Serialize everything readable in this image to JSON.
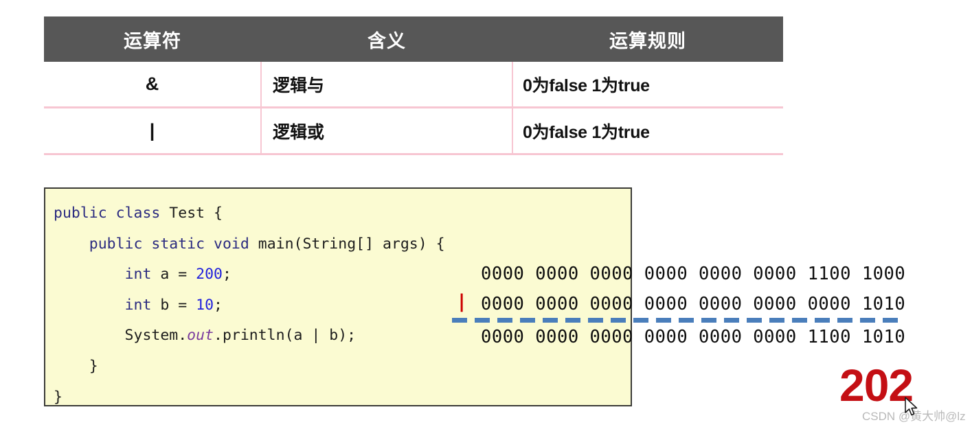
{
  "table": {
    "headers": [
      "运算符",
      "含义",
      "运算规则"
    ],
    "rows": [
      {
        "operator": "&",
        "meaning": "逻辑与",
        "rule": "0为false 1为true"
      },
      {
        "operator": "|",
        "meaning": "逻辑或",
        "rule": "0为false 1为true"
      }
    ],
    "colors": {
      "header_bg": "#575757",
      "header_text": "#ffffff",
      "divider": "#f7c6d2"
    }
  },
  "code": {
    "language": "java",
    "background": "#fbfbd2",
    "border": "#3a3a36",
    "lines": [
      {
        "tokens": [
          {
            "t": "public",
            "c": "kw"
          },
          {
            "t": " ",
            "c": "plain"
          },
          {
            "t": "class",
            "c": "kw"
          },
          {
            "t": " Test {",
            "c": "plain"
          }
        ]
      },
      {
        "tokens": [
          {
            "t": "    ",
            "c": "plain"
          },
          {
            "t": "public",
            "c": "kw"
          },
          {
            "t": " ",
            "c": "plain"
          },
          {
            "t": "static",
            "c": "kw"
          },
          {
            "t": " ",
            "c": "plain"
          },
          {
            "t": "void",
            "c": "kw"
          },
          {
            "t": " main(String[] args) {",
            "c": "plain"
          }
        ]
      },
      {
        "tokens": [
          {
            "t": "        ",
            "c": "plain"
          },
          {
            "t": "int",
            "c": "kw"
          },
          {
            "t": " a = ",
            "c": "plain"
          },
          {
            "t": "200",
            "c": "num"
          },
          {
            "t": ";",
            "c": "plain"
          }
        ]
      },
      {
        "tokens": [
          {
            "t": "        ",
            "c": "plain"
          },
          {
            "t": "int",
            "c": "kw"
          },
          {
            "t": " b = ",
            "c": "plain"
          },
          {
            "t": "10",
            "c": "num"
          },
          {
            "t": ";",
            "c": "plain"
          }
        ]
      },
      {
        "tokens": [
          {
            "t": "        System.",
            "c": "plain"
          },
          {
            "t": "out",
            "c": "fld"
          },
          {
            "t": ".println(a | b);",
            "c": "plain"
          }
        ]
      },
      {
        "tokens": [
          {
            "t": "    }",
            "c": "plain"
          }
        ]
      },
      {
        "tokens": [
          {
            "t": "}",
            "c": "plain"
          }
        ]
      }
    ]
  },
  "binary": {
    "operator": "|",
    "operator_color": "#cc0000",
    "divider_color": "#4a7ebb",
    "operand_a": "0000 0000 0000 0000 0000 0000 1100 1000",
    "operand_b": "0000 0000 0000 0000 0000 0000 0000 1010",
    "result": "0000 0000 0000 0000 0000 0000 1100 1010"
  },
  "page_number": "202",
  "watermark": "CSDN @黄大帅@lz",
  "cursor": "mouse-pointer"
}
